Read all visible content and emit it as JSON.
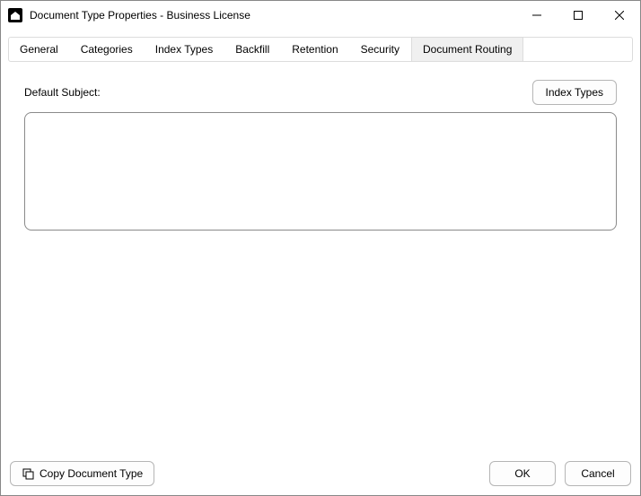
{
  "window": {
    "title": "Document Type Properties  - Business License"
  },
  "tabs": {
    "items": [
      {
        "label": "General"
      },
      {
        "label": "Categories"
      },
      {
        "label": "Index Types"
      },
      {
        "label": "Backfill"
      },
      {
        "label": "Retention"
      },
      {
        "label": "Security"
      },
      {
        "label": "Document Routing"
      }
    ],
    "activeIndex": 6
  },
  "routing": {
    "defaultSubjectLabel": "Default Subject:",
    "defaultSubjectValue": "",
    "indexTypesButton": "Index Types"
  },
  "footer": {
    "copyDocType": "Copy Document Type",
    "ok": "OK",
    "cancel": "Cancel"
  }
}
